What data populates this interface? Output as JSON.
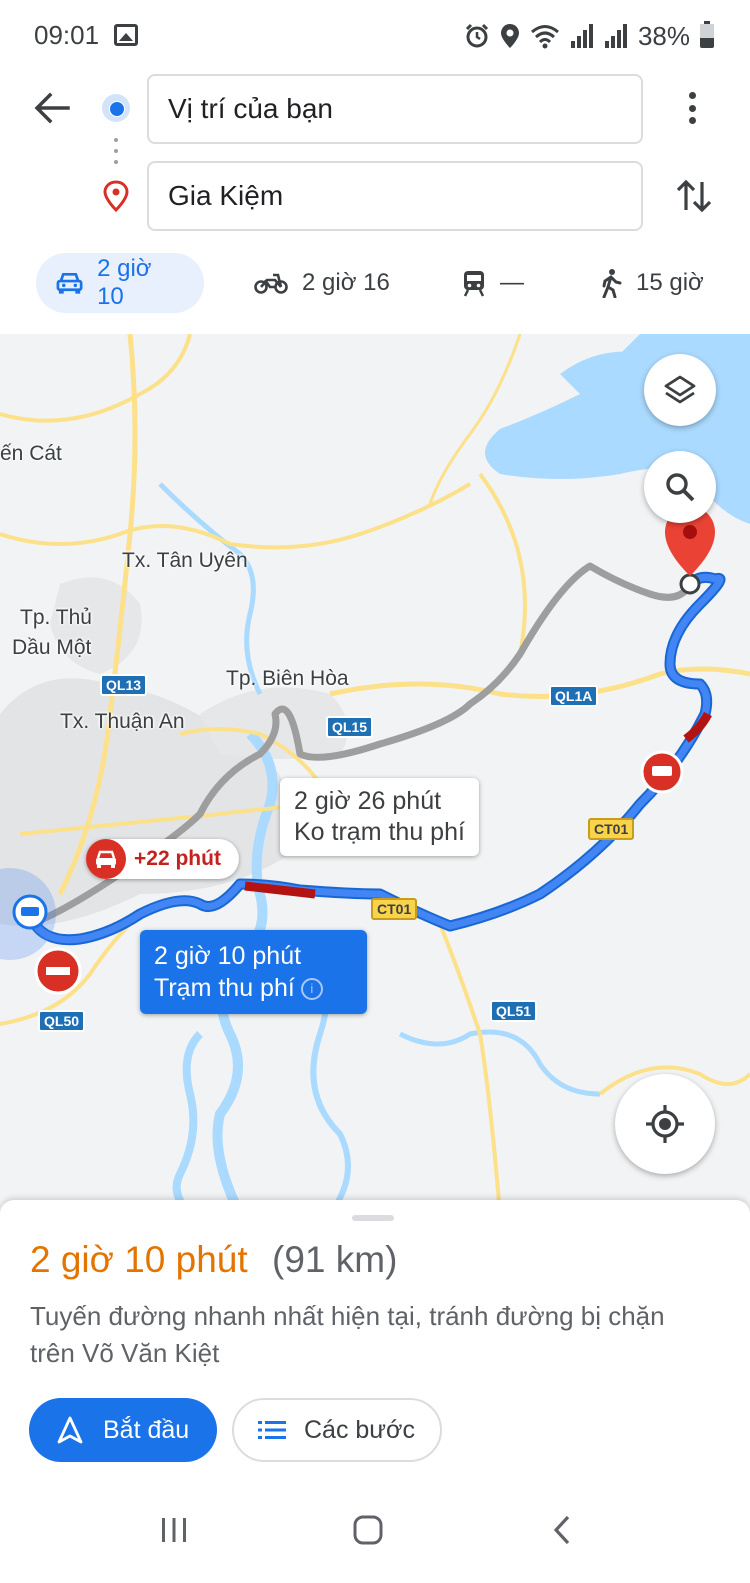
{
  "status_bar": {
    "time": "09:01",
    "battery": "38%",
    "icons": [
      "image-icon",
      "alarm-icon",
      "location-icon",
      "wifi-icon",
      "signal-icon",
      "signal-icon",
      "battery-icon"
    ]
  },
  "search": {
    "origin_value": "Vị trí của bạn",
    "destination_value": "Gia Kiệm"
  },
  "modes": [
    {
      "name": "car",
      "label": "2 giờ 10",
      "active": true
    },
    {
      "name": "motorbike",
      "label": "2 giờ 16",
      "active": false
    },
    {
      "name": "transit",
      "label": "—",
      "active": false
    },
    {
      "name": "walk",
      "label": "15 giờ",
      "active": false
    }
  ],
  "map": {
    "places": [
      "ến Cát",
      "Tx. Tân Uyên",
      "Tp. Thủ",
      "Dầu Một",
      "Tp. Biên Hòa",
      "Tx. Thuận An"
    ],
    "shields": [
      "QL13",
      "QL15",
      "QL1A",
      "CT01",
      "CT01",
      "QL50",
      "QL51"
    ],
    "alt_route": {
      "line1": "2 giờ 26 phút",
      "line2": "Ko trạm thu phí"
    },
    "main_route": {
      "line1": "2 giờ 10 phút",
      "line2": "Trạm thu phí"
    },
    "delay": "+22 phút",
    "colors": {
      "route": "#4285f4",
      "alt_route": "#9e9e9e",
      "traffic": "#d93025",
      "water": "#aadaff"
    }
  },
  "sheet": {
    "time": "2 giờ 10 phút",
    "distance": "(91 km)",
    "description": "Tuyến đường nhanh nhất hiện tại, tránh đường bị chặn trên Võ Văn Kiệt",
    "start_label": "Bắt đầu",
    "steps_label": "Các bước"
  }
}
